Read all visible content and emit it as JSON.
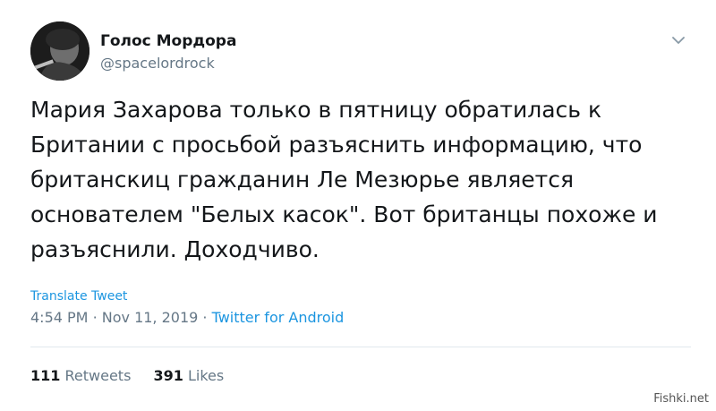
{
  "author": {
    "display_name": "Голос Мордора",
    "handle": "@spacelordrock",
    "avatar_icon": "avatar-photo"
  },
  "menu_icon": "chevron-down-icon",
  "tweet": {
    "lines": [
      "Мария Захарова только в пятницу обратилась к",
      "Британии с просьбой разъяснить информацию, что",
      "британскиц гражданин Ле Мезюрье является",
      "основателем \"Белых касок\". Вот британцы похоже и",
      "разъяснили. Доходчиво."
    ],
    "translate_label": "Translate Tweet"
  },
  "meta": {
    "time": "4:54 PM",
    "separator": "·",
    "date": "Nov 11, 2019",
    "source": "Twitter for Android"
  },
  "stats": {
    "retweets_count": "111",
    "retweets_label": "Retweets",
    "likes_count": "391",
    "likes_label": "Likes"
  },
  "watermark": "Fishki.net",
  "colors": {
    "text": "#14171a",
    "secondary": "#657786",
    "link": "#1b95e0",
    "divider": "#e1e8ed"
  }
}
